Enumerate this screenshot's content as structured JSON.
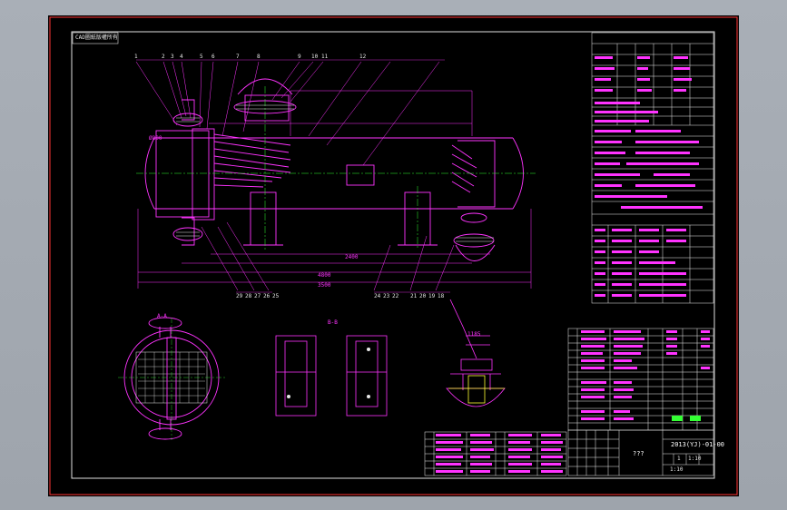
{
  "title_block": {
    "drawing_no": "2013(YJ)-01-00",
    "name_placeholder": "???",
    "sheet": "1",
    "scale": "1:10",
    "sub_no": "1:10"
  },
  "corner_tag": "CAD圖紙版權所有",
  "views": {
    "section_aa": "A-A",
    "section_bb": "B-B"
  },
  "part_numbers": {
    "top_left": [
      "1",
      "2",
      "3",
      "4",
      "5",
      "6",
      "7",
      "8",
      "9",
      "10",
      "11",
      "12"
    ],
    "bottom": [
      "29",
      "28",
      "27",
      "26",
      "25",
      "24",
      "23",
      "22",
      "21",
      "20",
      "19",
      "18"
    ]
  },
  "dimensions": {
    "overall_length": "4800",
    "base_span": "3500",
    "nozzle_span": "2400",
    "shell_dia": "Ø800",
    "detail_dim": "1185"
  },
  "colors": {
    "frame": "#e0e0e0",
    "geometry": "#ff33ff",
    "text": "#e8e8e8",
    "grid": "#f0f0f0",
    "background": "#000000",
    "accent_cyan": "#33ffff",
    "accent_green": "#33ff33",
    "accent_yellow": "#ffff33"
  }
}
